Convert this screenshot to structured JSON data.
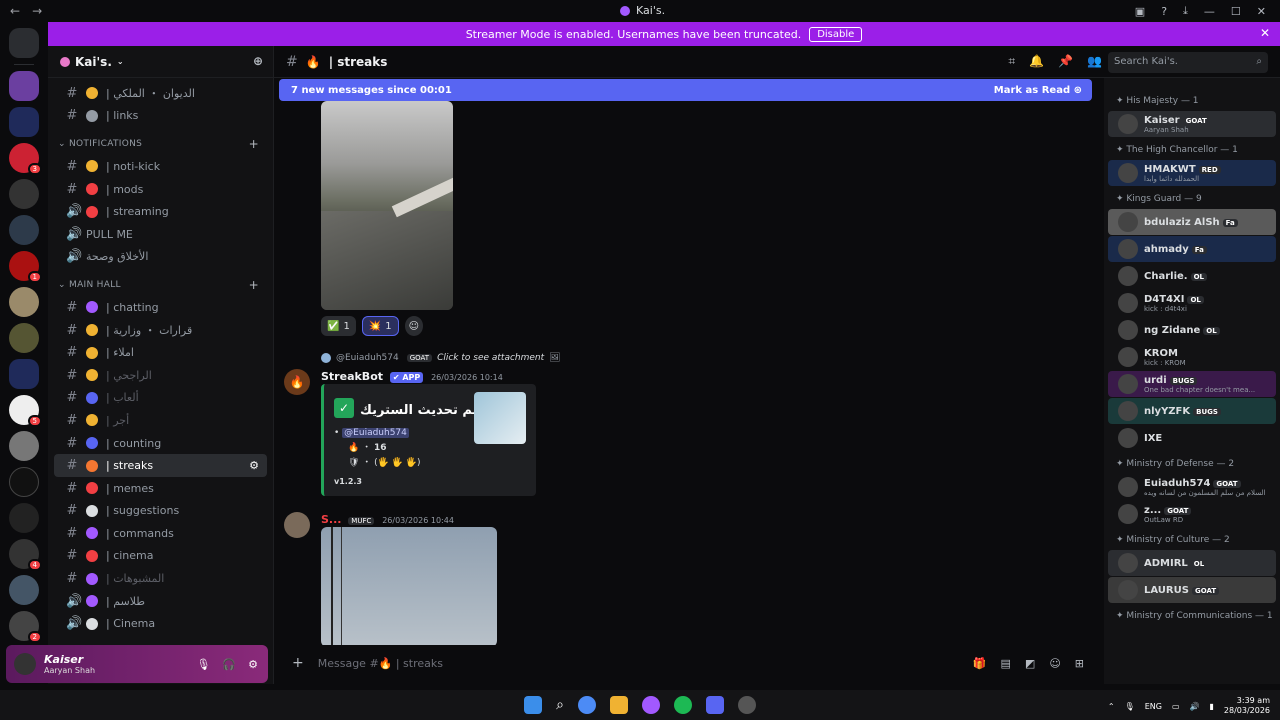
{
  "window": {
    "title": "Kai's."
  },
  "banner": {
    "text": "Streamer Mode is enabled. Usernames have been truncated.",
    "button": "Disable"
  },
  "server": {
    "name": "Kai's."
  },
  "channels": [
    {
      "label": "| الديوان ・ الملكي",
      "icon": "#",
      "color": "#f0b232"
    },
    {
      "label": "| links",
      "icon": "#",
      "color": "#949ba4"
    },
    {
      "type": "category",
      "label": "NOTIFICATIONS"
    },
    {
      "label": "| noti-kick",
      "icon": "#",
      "color": "#f0b232"
    },
    {
      "label": "| mods",
      "icon": "#",
      "color": "#f23f43"
    },
    {
      "label": "| streaming",
      "icon": "speaker",
      "color": "#f23f43"
    },
    {
      "label": "PULL ME",
      "icon": "speaker"
    },
    {
      "label": "الأخلاق وصحة",
      "icon": "speaker"
    },
    {
      "type": "category",
      "label": "MAIN HALL"
    },
    {
      "label": "| chatting",
      "icon": "#",
      "color": "#a259ff"
    },
    {
      "label": "| قرارات ・ وزارية",
      "icon": "#",
      "color": "#f0b232"
    },
    {
      "label": "| املاء",
      "icon": "#",
      "color": "#f0b232"
    },
    {
      "label": "| الراجحي",
      "icon": "#",
      "color": "#f0b232",
      "muted": true
    },
    {
      "label": "| ألعاب",
      "icon": "#",
      "color": "#5865f2",
      "muted": true
    },
    {
      "label": "| أجر",
      "icon": "#",
      "color": "#f0b232",
      "muted": true
    },
    {
      "label": "| counting",
      "icon": "#",
      "color": "#5865f2"
    },
    {
      "label": "| streaks",
      "icon": "#",
      "color": "#f57731",
      "active": true
    },
    {
      "label": "| memes",
      "icon": "#",
      "color": "#f23f43"
    },
    {
      "label": "| suggestions",
      "icon": "#",
      "color": "#dbdee1"
    },
    {
      "label": "| commands",
      "icon": "#",
      "color": "#a259ff"
    },
    {
      "label": "| cinema",
      "icon": "#",
      "color": "#f23f43"
    },
    {
      "label": "| المشبوهات",
      "icon": "#",
      "color": "#a259ff",
      "muted": true
    },
    {
      "label": "| طلاسم",
      "icon": "speaker",
      "color": "#a259ff"
    },
    {
      "label": "| Cinema",
      "icon": "speaker",
      "color": "#dbdee1"
    }
  ],
  "user_panel": {
    "name": "Kaiser",
    "status": "Aaryan Shah"
  },
  "header": {
    "channel": "| streaks",
    "search_placeholder": "Search Kai's."
  },
  "new_messages": {
    "text": "7 new messages since 00:01",
    "action": "Mark as Read"
  },
  "reactions": [
    {
      "emoji": "✅",
      "count": "1"
    },
    {
      "emoji": "💥",
      "count": "1",
      "me": true
    }
  ],
  "reply": {
    "user": "@Euiaduh574",
    "badge": "GOAT",
    "text": "Click to see attachment"
  },
  "bot_message": {
    "author": "StreakBot",
    "tag": "✔ APP",
    "time": "26/03/2026 10:14",
    "embed_title": "تم تحديث الستريك ・",
    "mention": "@Euiaduh574",
    "streak": "16",
    "line2": "・ (🖐 🖐 🖐)",
    "version": "v1.2.3"
  },
  "second_message": {
    "author": "S...",
    "badge": "MUFC",
    "time": "26/03/2026 10:44"
  },
  "composer": {
    "placeholder": "Message #🔥 | streaks"
  },
  "members": [
    {
      "type": "cat",
      "label": "✦ His Majesty — 1"
    },
    {
      "name": "Kaiser",
      "badge": "GOAT",
      "status": "Aaryan Shah",
      "bg": "#2b2d31"
    },
    {
      "type": "cat",
      "label": "✦ The High Chancellor — 1"
    },
    {
      "name": "HMAKWT",
      "badge": "RED",
      "status": "الحمدلله دائما وابدا",
      "bg": "#1a2a4a"
    },
    {
      "type": "cat",
      "label": "✦ Kings Guard — 9"
    },
    {
      "name": "bdulaziz AlSh",
      "badge": "Fa",
      "status": "",
      "bg": "#5a5a5a"
    },
    {
      "name": "ahmady",
      "badge": "Fa",
      "status": "",
      "bg": "#1a2a4a"
    },
    {
      "name": "Charlie.",
      "badge": "OL",
      "status": "",
      "bg": ""
    },
    {
      "name": "D4T4XI",
      "badge": "OL",
      "status": "kick : d4t4xi",
      "bg": ""
    },
    {
      "name": "ng Zidane",
      "badge": "OL",
      "status": "",
      "bg": ""
    },
    {
      "name": "KROM",
      "badge": "",
      "status": "kick : KROM",
      "bg": ""
    },
    {
      "name": "urdi",
      "badge": "BUGS",
      "status": "One bad chapter doesn't mea...",
      "bg": "#3a1a4a"
    },
    {
      "name": "nlyYZFK",
      "badge": "BUGS",
      "status": "",
      "bg": "#1a3a3a"
    },
    {
      "name": "IXE",
      "badge": "",
      "status": "",
      "bg": ""
    },
    {
      "type": "cat",
      "label": "✦ Ministry of Defense — 2"
    },
    {
      "name": "Euiaduh574",
      "badge": "GOAT",
      "status": "السلام من سلم المسلمون من لسانه ويده",
      "bg": ""
    },
    {
      "name": "z...",
      "badge": "GOAT",
      "status": "OutLaw RD",
      "bg": ""
    },
    {
      "type": "cat",
      "label": "✦ Ministry of Culture — 2"
    },
    {
      "name": "ADMIRL",
      "badge": "OL",
      "status": "",
      "bg": "#2b2d31"
    },
    {
      "name": "LAURUS",
      "badge": "GOAT",
      "status": "",
      "bg": "#3a3a3a"
    },
    {
      "type": "cat",
      "label": "✦ Ministry of Communications — 1"
    }
  ],
  "tray": {
    "lang": "ENG",
    "time": "3:39 am",
    "date": "28/03/2026"
  }
}
